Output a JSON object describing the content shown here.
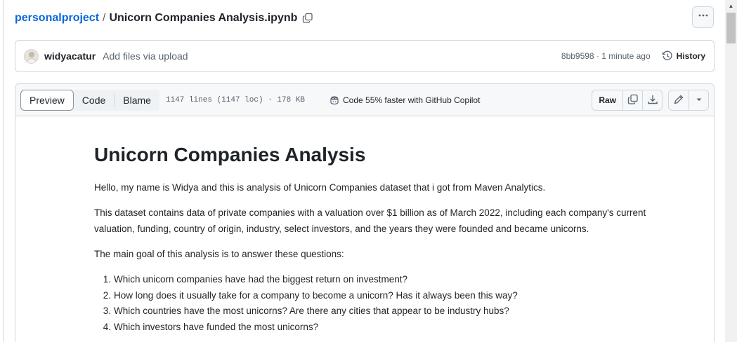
{
  "breadcrumb": {
    "repo": "personalproject",
    "separator": "/",
    "file": "Unicorn Companies Analysis.ipynb"
  },
  "icons": {
    "copy": "copy-icon",
    "more": "kebab-horizontal-icon",
    "history": "history-clock-icon",
    "copilot": "copilot-icon",
    "symlink": "copy-raw-icon",
    "download": "download-icon",
    "edit": "pencil-icon",
    "dropdown": "triangle-down-icon"
  },
  "commit": {
    "user": "widyacatur",
    "message": "Add files via upload",
    "meta": "8bb9598 · 1 minute ago",
    "history_label": "History"
  },
  "file_header": {
    "tabs": [
      "Preview",
      "Code",
      "Blame"
    ],
    "active_tab": "Preview",
    "info": "1147 lines (1147 loc) · 178 KB",
    "copilot_text": "Code 55% faster with GitHub Copilot",
    "raw_label": "Raw"
  },
  "markdown": {
    "title": "Unicorn Companies Analysis",
    "intro": "Hello, my name is Widya and this is analysis of Unicorn Companies dataset that i got from Maven Analytics.",
    "description": "This dataset contains data of private companies with a valuation over $1 billion as of March 2022, including each company's current valuation, funding, country of origin, industry, select investors, and the years they were founded and became unicorns.",
    "goal": "The main goal of this analysis is to answer these questions:",
    "questions": [
      {
        "num": "1.",
        "text": "Which unicorn companies have had the biggest return on investment?"
      },
      {
        "num": "2.",
        "text": "How long does it usually take for a company to become a unicorn? Has it always been this way?"
      },
      {
        "num": "3.",
        "text": "Which countries have the most unicorns? Are there any cities that appear to be industry hubs?"
      },
      {
        "num": "4.",
        "text": "Which investors have funded the most unicorns?"
      }
    ]
  },
  "colors": {
    "link": "#0969da",
    "border": "#d0d7de",
    "header_bg": "#f6f8fa",
    "text": "#1f2328",
    "muted": "#59636e"
  }
}
